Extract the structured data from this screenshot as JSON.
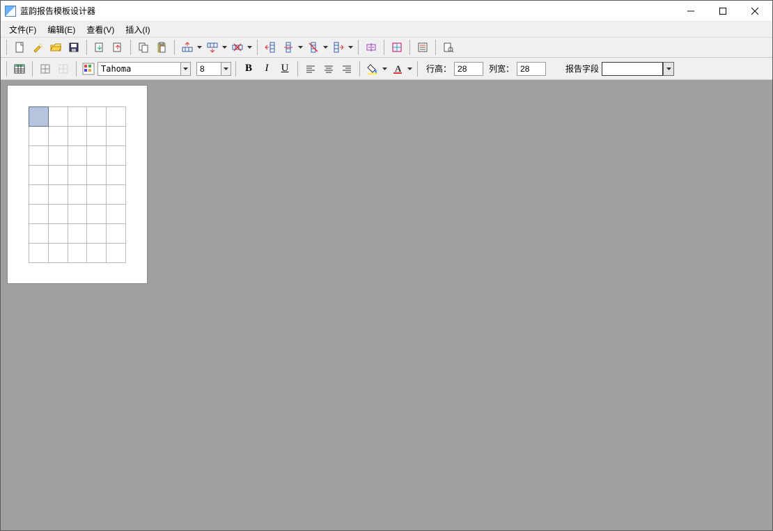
{
  "window": {
    "title": "蓝韵报告模板设计器"
  },
  "menu": {
    "file": "文件(F)",
    "edit": "编辑(E)",
    "view": "查看(V)",
    "insert": "插入(I)"
  },
  "toolbar2": {
    "font_name": "Tahoma",
    "font_size": "8",
    "bold": "B",
    "italic": "I",
    "underline": "U",
    "row_height_label": "行高：",
    "row_height_value": "28",
    "col_width_label": "列宽：",
    "col_width_value": "28",
    "report_field_label": "报告字段",
    "report_field_value": ""
  },
  "grid": {
    "rows": 8,
    "cols": 5,
    "selected_row": 0,
    "selected_col": 0
  }
}
